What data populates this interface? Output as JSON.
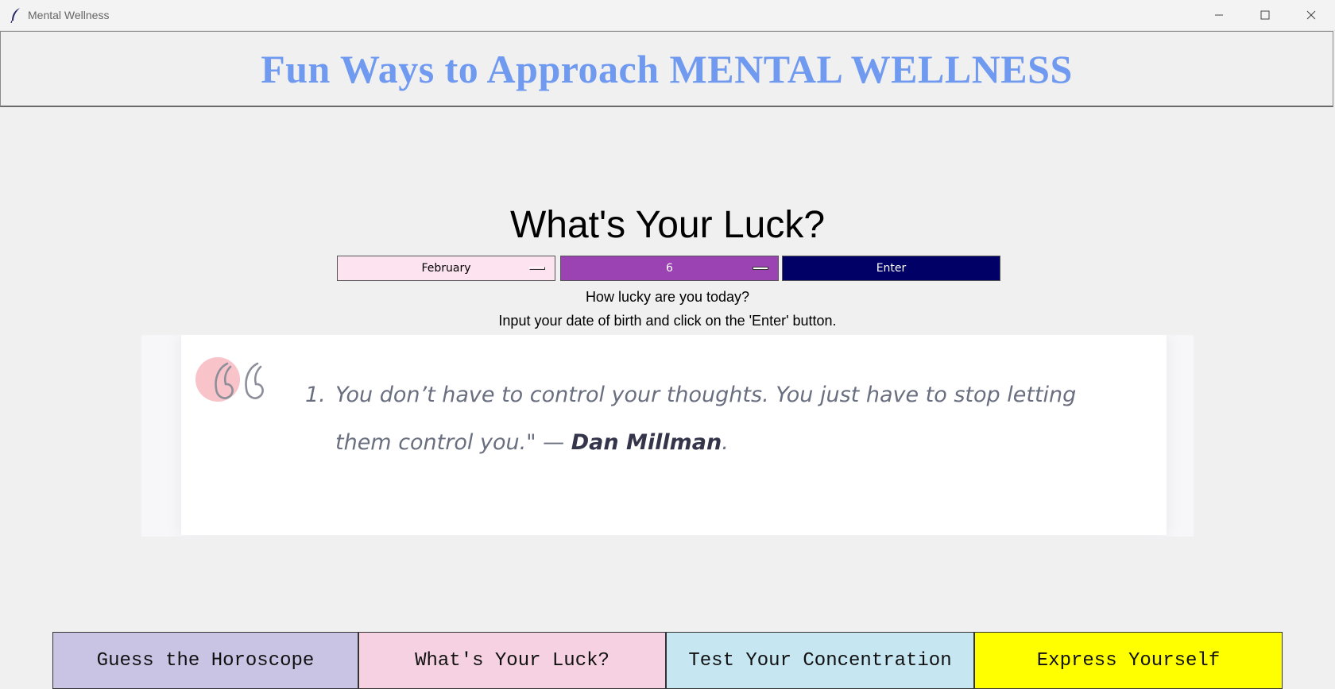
{
  "window": {
    "title": "Mental Wellness",
    "icon": "feather-icon",
    "controls": [
      "minimize-icon",
      "maximize-icon",
      "close-icon"
    ]
  },
  "header": {
    "title": "Fun Ways to Approach MENTAL WELLNESS",
    "color": "#6f9af0"
  },
  "luck": {
    "title": "What's Your Luck?",
    "month_value": "February",
    "day_value": "6",
    "enter_label": "Enter",
    "line1": "How lucky are you today?",
    "line2": "Input your date of birth and click on the 'Enter' button."
  },
  "quote": {
    "number": "1.",
    "text": "You don’t have to control your thoughts. You just have to stop letting them control you.\" — ",
    "author": "Dan Millman",
    "end": ".",
    "icon": "quote-icon"
  },
  "nav": {
    "horoscope": "Guess the Horoscope",
    "luck": "What's Your Luck?",
    "concentration": "Test Your Concentration",
    "express": "Express Yourself"
  },
  "colors": {
    "month_bg": "#fde3f0",
    "day_bg": "#9b43b2",
    "enter_bg": "#000066",
    "nav_horoscope": "#c9c3e4",
    "nav_luck": "#f5d1e1",
    "nav_concentration": "#c6e6f2",
    "nav_express": "#ffff00"
  }
}
